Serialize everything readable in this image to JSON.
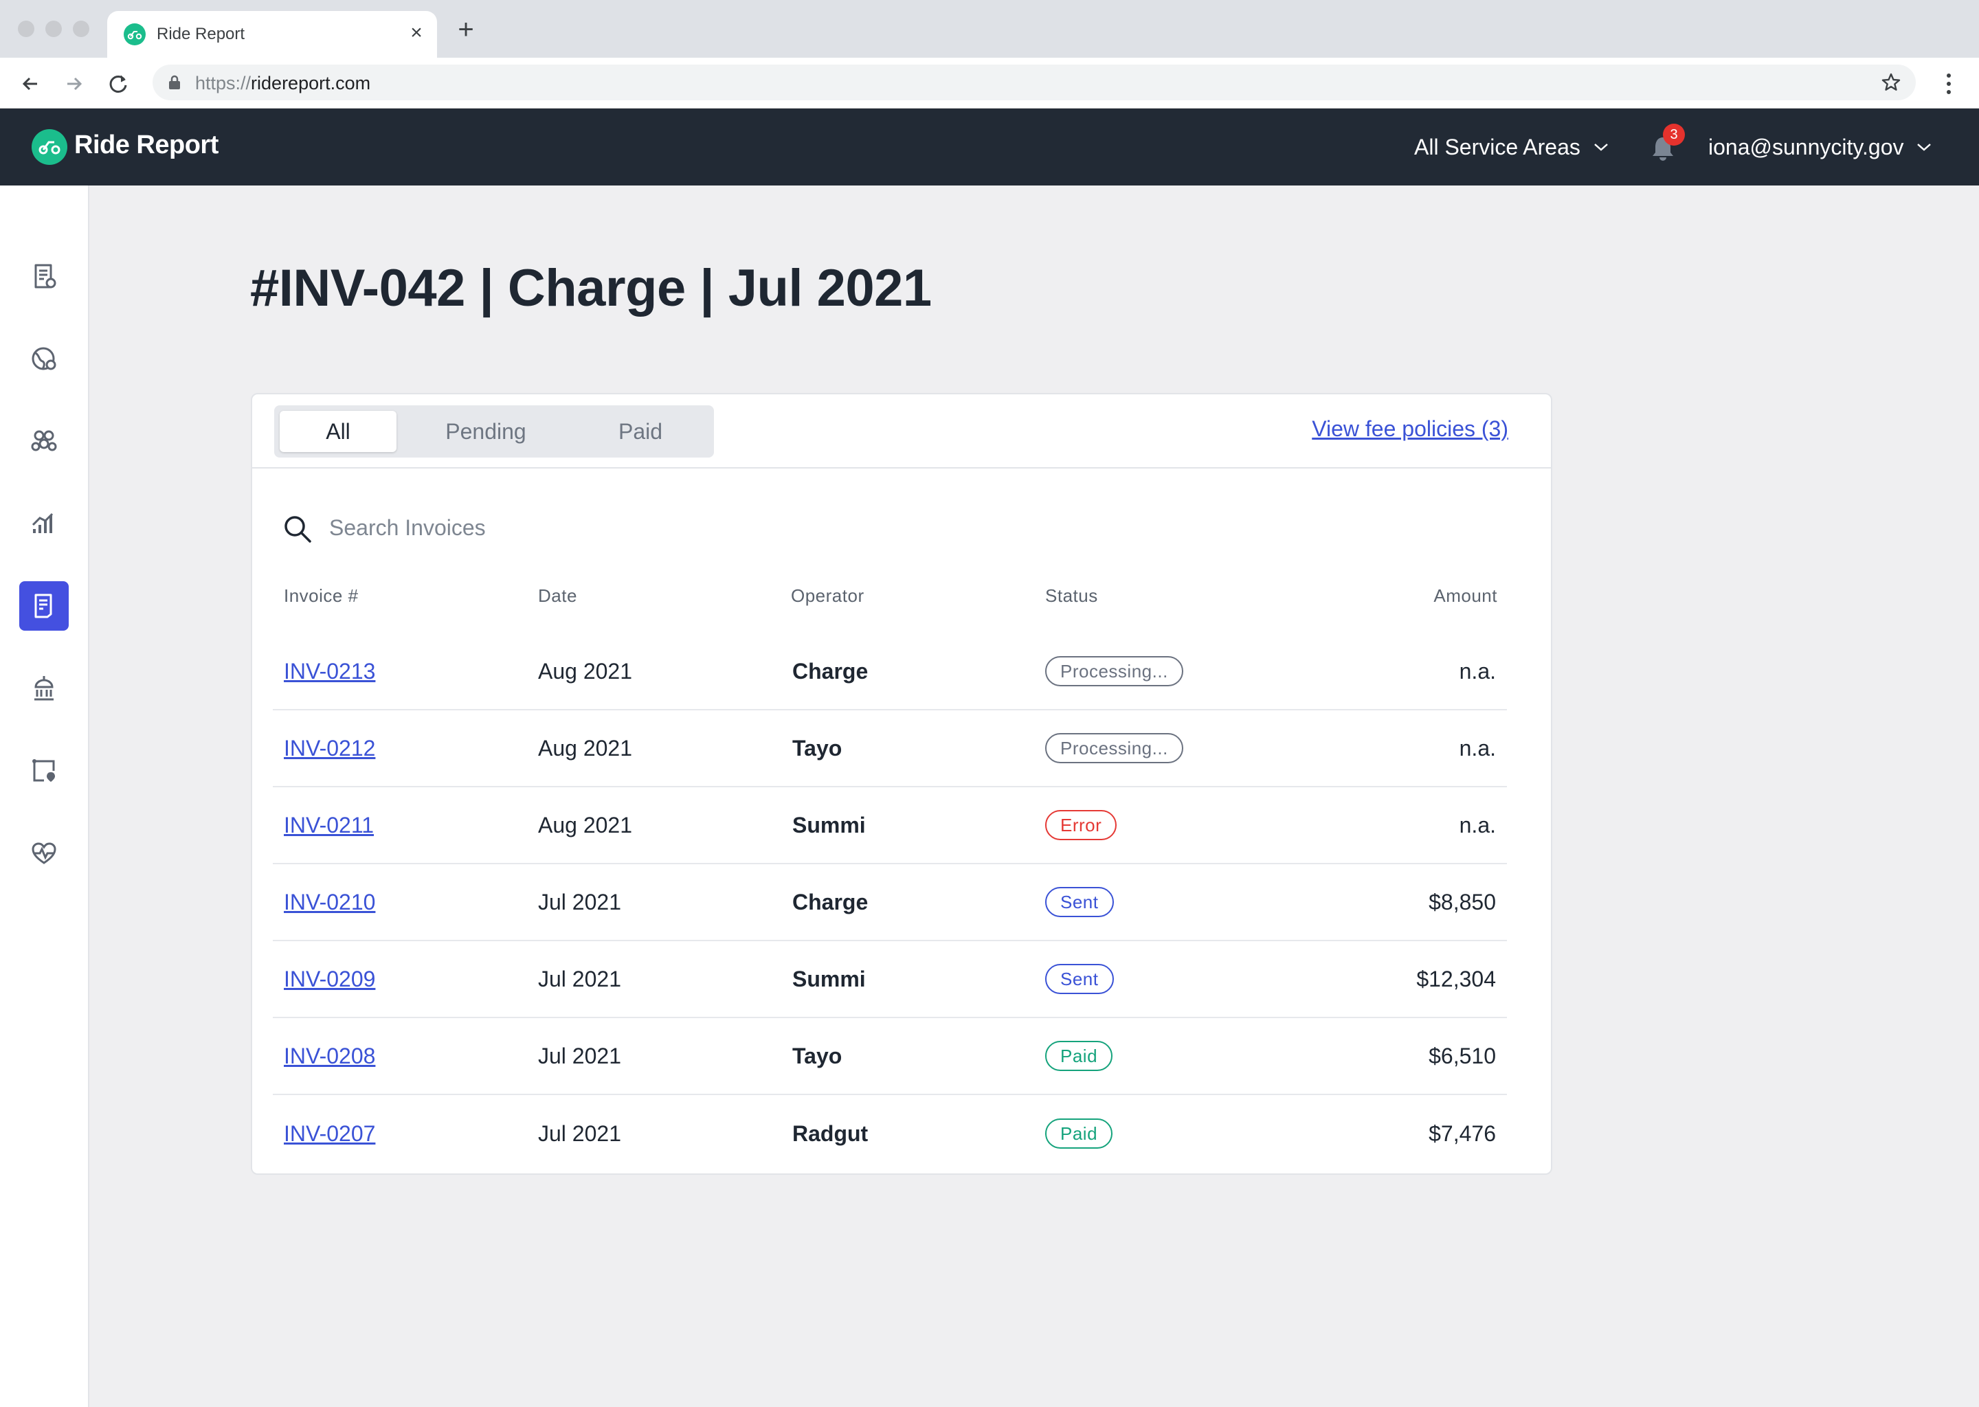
{
  "browser": {
    "tab_title": "Ride Report",
    "url_scheme": "https://",
    "url_host": "ridereport.com"
  },
  "app": {
    "brand": "Ride Report",
    "service_area": "All Service Areas",
    "notification_count": "3",
    "user_email": "iona@sunnycity.gov"
  },
  "sidebar": {
    "items": [
      {
        "icon": "report-icon",
        "active": false
      },
      {
        "icon": "map-globe-icon",
        "active": false
      },
      {
        "icon": "hex-cluster-icon",
        "active": false
      },
      {
        "icon": "analytics-icon",
        "active": false
      },
      {
        "icon": "invoice-icon",
        "active": true
      },
      {
        "icon": "government-building-icon",
        "active": false
      },
      {
        "icon": "geofence-icon",
        "active": false
      },
      {
        "icon": "health-icon",
        "active": false
      }
    ]
  },
  "page": {
    "title": "#INV-042 | Charge | Jul 2021"
  },
  "filters": {
    "tabs": [
      "All",
      "Pending",
      "Paid"
    ],
    "active": "All",
    "policies_link": "View fee policies (3)"
  },
  "search": {
    "placeholder": "Search Invoices",
    "value": ""
  },
  "table": {
    "columns": [
      "Invoice #",
      "Date",
      "Operator",
      "Status",
      "Amount"
    ],
    "rows": [
      {
        "invoice": "INV-0213",
        "date": "Aug 2021",
        "operator": "Charge",
        "status": "Processing...",
        "status_type": "processing",
        "amount": "n.a."
      },
      {
        "invoice": "INV-0212",
        "date": "Aug 2021",
        "operator": "Tayo",
        "status": "Processing...",
        "status_type": "processing",
        "amount": "n.a."
      },
      {
        "invoice": "INV-0211",
        "date": "Aug 2021",
        "operator": "Summi",
        "status": "Error",
        "status_type": "error",
        "amount": "n.a."
      },
      {
        "invoice": "INV-0210",
        "date": "Jul 2021",
        "operator": "Charge",
        "status": "Sent",
        "status_type": "sent",
        "amount": "$8,850"
      },
      {
        "invoice": "INV-0209",
        "date": "Jul 2021",
        "operator": "Summi",
        "status": "Sent",
        "status_type": "sent",
        "amount": "$12,304"
      },
      {
        "invoice": "INV-0208",
        "date": "Jul 2021",
        "operator": "Tayo",
        "status": "Paid",
        "status_type": "paid",
        "amount": "$6,510"
      },
      {
        "invoice": "INV-0207",
        "date": "Jul 2021",
        "operator": "Radgut",
        "status": "Paid",
        "status_type": "paid",
        "amount": "$7,476"
      }
    ]
  },
  "colors": {
    "header_bg": "#222a35",
    "brand_green": "#1bbd8c",
    "accent_blue": "#4450e0",
    "link_blue": "#3a52d6",
    "status_processing": "#6b7280",
    "status_error": "#e53935",
    "status_sent": "#3a52d6",
    "status_paid": "#15a37c"
  }
}
